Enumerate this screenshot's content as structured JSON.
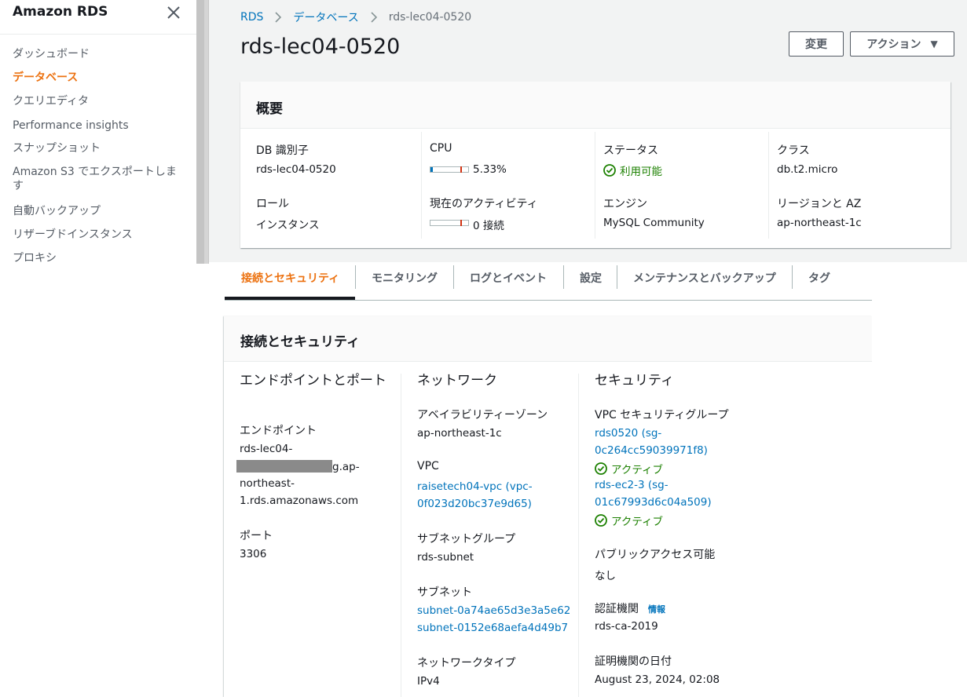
{
  "sidebar": {
    "title": "Amazon RDS",
    "items": [
      {
        "label": "ダッシュボード",
        "active": false
      },
      {
        "label": "データベース",
        "active": true
      },
      {
        "label": "クエリエディタ",
        "active": false
      },
      {
        "label": "Performance insights",
        "active": false
      },
      {
        "label": "スナップショット",
        "active": false
      },
      {
        "label": "Amazon S3 でエクスポートします",
        "active": false
      },
      {
        "label": "自動バックアップ",
        "active": false
      },
      {
        "label": "リザーブドインスタンス",
        "active": false
      },
      {
        "label": "プロキシ",
        "active": false
      }
    ]
  },
  "breadcrumb": [
    "RDS",
    "データベース",
    "rds-lec04-0520"
  ],
  "page_title": "rds-lec04-0520",
  "buttons": {
    "modify": "変更",
    "action": "アクション"
  },
  "summary": {
    "title": "概要",
    "db_identifier_label": "DB 識別子",
    "db_identifier": "rds-lec04-0520",
    "cpu_label": "CPU",
    "cpu_value": "5.33%",
    "cpu_fraction": 0.0533,
    "status_label": "ステータス",
    "status_value": "利用可能",
    "class_label": "クラス",
    "class_value": "db.t2.micro",
    "role_label": "ロール",
    "role_value": "インスタンス",
    "activity_label": "現在のアクティビティ",
    "activity_value": "0 接続",
    "engine_label": "エンジン",
    "engine_value": "MySQL Community",
    "region_label": "リージョンと AZ",
    "region_value": "ap-northeast-1c"
  },
  "tabs": [
    "接続とセキュリティ",
    "モニタリング",
    "ログとイベント",
    "設定",
    "メンテナンスとバックアップ",
    "タグ"
  ],
  "connectivity": {
    "title": "接続とセキュリティ",
    "endpoint_col": {
      "heading": "エンドポイントとポート",
      "endpoint_label": "エンドポイント",
      "endpoint_line1": "rds-lec04-",
      "endpoint_line2_suffix": "g.ap-",
      "endpoint_line3": "northeast-",
      "endpoint_line4": "1.rds.amazonaws.com",
      "port_label": "ポート",
      "port_value": "3306"
    },
    "network_col": {
      "heading": "ネットワーク",
      "az_label": "アベイラビリティーゾーン",
      "az_value": "ap-northeast-1c",
      "vpc_label": "VPC",
      "vpc_line1": "raisetech04-vpc (vpc-",
      "vpc_line2": "0f023d20bc37e9d65)",
      "subnet_group_label": "サブネットグループ",
      "subnet_group_value": "rds-subnet",
      "subnet_label": "サブネット",
      "subnet1": "subnet-0a74ae65d3e3a5e62",
      "subnet2": "subnet-0152e68aefa4d49b7",
      "network_type_label": "ネットワークタイプ",
      "network_type_value": "IPv4"
    },
    "security_col": {
      "heading": "セキュリティ",
      "vpc_sg_label": "VPC セキュリティグループ",
      "sg1_line1": "rds0520 (sg-",
      "sg1_line2": "0c264cc59039971f8)",
      "sg1_status": "アクティブ",
      "sg2_line1": "rds-ec2-3 (sg-",
      "sg2_line2": "01c67993d6c04a509)",
      "sg2_status": "アクティブ",
      "public_label": "パブリックアクセス可能",
      "public_value": "なし",
      "ca_label": "認証機関",
      "ca_info": "情報",
      "ca_value": "rds-ca-2019",
      "ca_date_label": "証明機関の日付",
      "ca_date_value": "August 23, 2024, 02:08"
    }
  },
  "colors": {
    "accent": "#ec7211",
    "link": "#0073bb",
    "success": "#1d8102"
  }
}
